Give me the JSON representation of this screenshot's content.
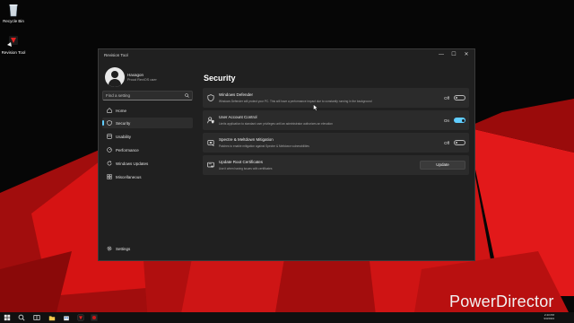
{
  "desktop": {
    "icons": [
      {
        "label": "Recycle Bin",
        "icon": "recycle-bin-icon"
      },
      {
        "label": "Revision Tool",
        "icon": "revision-tool-icon"
      }
    ]
  },
  "window": {
    "title": "Revision Tool",
    "controls": {
      "minimize": "—",
      "maximize": "☐",
      "close": "✕"
    }
  },
  "sidebar": {
    "user": {
      "name": "Haxagon",
      "subtitle": "Proud ReviOS user"
    },
    "search_placeholder": "Find a setting",
    "items": [
      {
        "label": "Home",
        "icon": "home-icon"
      },
      {
        "label": "Security",
        "icon": "shield-icon",
        "active": true
      },
      {
        "label": "Usability",
        "icon": "usability-icon"
      },
      {
        "label": "Performance",
        "icon": "performance-icon"
      },
      {
        "label": "Windows Updates",
        "icon": "windows-update-icon"
      },
      {
        "label": "Miscellaneous",
        "icon": "miscellaneous-icon"
      }
    ],
    "settings_label": "Settings"
  },
  "main": {
    "title": "Security",
    "cards": [
      {
        "title": "Windows Defender",
        "description": "Windows Defender will protect your PC. This will have a performance impact due to constantly running in the background",
        "state": "Off",
        "on": false
      },
      {
        "title": "User Account Control",
        "description": "Limits application to standard user privileges until an administrator authorizes an elevation",
        "state": "On",
        "on": true
      },
      {
        "title": "Spectre & Meltdown Mitigation",
        "description": "Patches to enable mitigation against Spectre & Meltdown vulnerabilities",
        "state": "Off",
        "on": false
      },
      {
        "title": "Update Root Certificates",
        "description": "Use it when having issues with certificates",
        "button": "Update"
      }
    ]
  },
  "taskbar": {
    "time": "2:43 PM",
    "date": "9/3/2023"
  },
  "watermark": "PowerDirector",
  "colors": {
    "accent": "#60cdff",
    "window_bg": "#202020",
    "card_bg": "#2b2b2b",
    "wallpaper_red": "#d81414"
  }
}
